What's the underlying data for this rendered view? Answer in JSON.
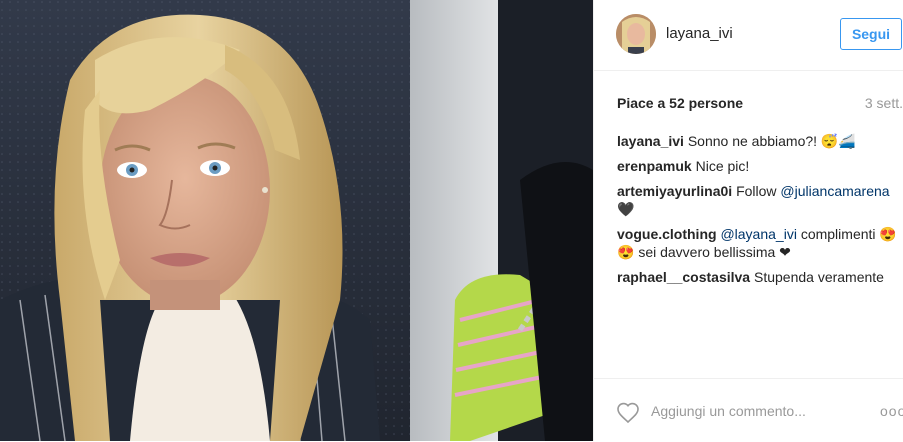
{
  "post": {
    "username": "layana_ivi",
    "follow_label": "Segui",
    "likes_text": "Piace a 52 persone",
    "time_ago": "3 sett.",
    "comments": [
      {
        "user": "layana_ivi",
        "text": "Sonno ne abbiamo?! 😴🚄"
      },
      {
        "user": "erenpamuk",
        "text": "Nice pic!"
      },
      {
        "user": "artemiyayurlina0i",
        "text": "Follow ",
        "mention": "@juliancamarena",
        "after": " 🖤"
      },
      {
        "user": "vogue.clothing",
        "mention": "@layana_ivi",
        "text": " complimenti 😍 😍 sei davvero bellissima ❤"
      },
      {
        "user": "raphael__costasilva",
        "text": "Stupenda veramente"
      }
    ],
    "add_comment_placeholder": "Aggiungi un commento...",
    "more_label": "ooo"
  },
  "colors": {
    "follow": "#3897f0",
    "mention": "#003569",
    "muted": "#999999"
  },
  "icons": [
    "avatar",
    "heart-icon",
    "more-options-icon"
  ]
}
